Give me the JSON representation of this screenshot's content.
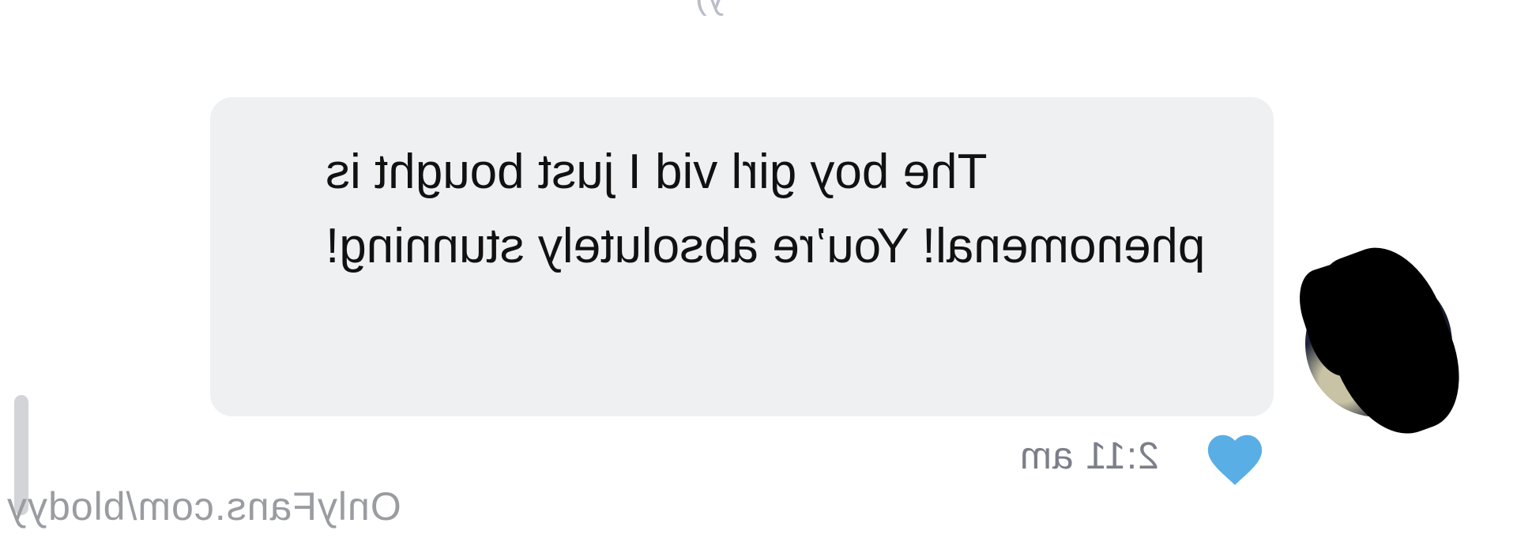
{
  "chat": {
    "top_fragment": "y)",
    "message": {
      "text": "The boy girl vid I just bought is phenomenal! You’re absolutely stunning!",
      "time": "2:11 am",
      "liked": true,
      "like_color": "#5aaee6"
    },
    "avatar": {
      "label": "sender avatar"
    }
  },
  "watermark": {
    "text": "OnlyFans.com/blodyy"
  },
  "colors": {
    "bubble_bg": "#eff0f2",
    "text": "#111111",
    "meta": "#7c7f89",
    "watermark": "#9a9ca1"
  }
}
